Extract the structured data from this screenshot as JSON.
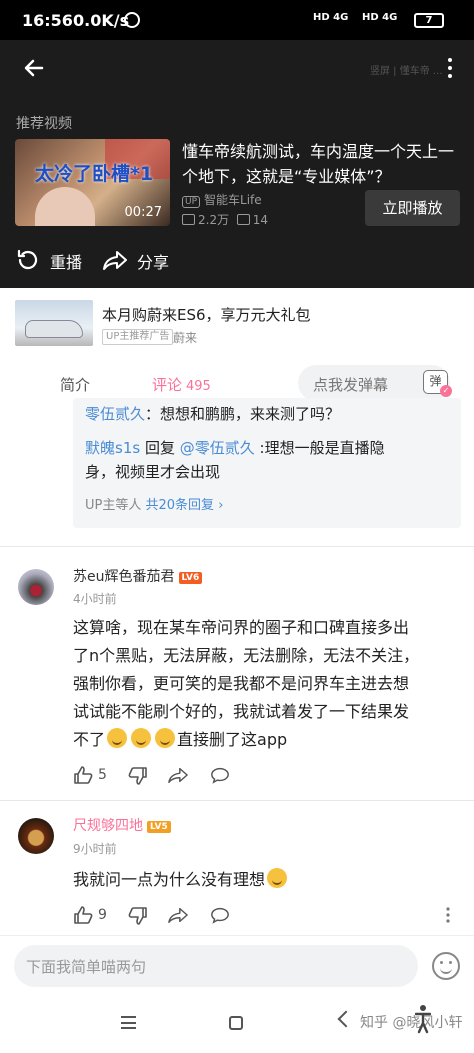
{
  "status_bar": {
    "time": "16:56",
    "net_speed": "0.0K/s",
    "sim1": "HD 4G",
    "sim2": "HD 4G",
    "battery": "7"
  },
  "video_overlay": {
    "ghost_text": "竖屏 | 懂车帝 ..."
  },
  "recommended": {
    "section_title": "推荐视频",
    "thumb_caption": "太冷了卧槽*1",
    "duration": "00:27",
    "title": "懂车帝续航测试，车内温度一个天上一个地下，这就是“专业媒体”？",
    "author_badge": "UP",
    "author": "智能车Life",
    "plays": "2.2万",
    "danmaku": "14",
    "play_now": "立即播放"
  },
  "actions": {
    "replay": "重播",
    "share": "分享"
  },
  "ad": {
    "title": "本月购蔚来ES6，享万元大礼包",
    "tag": "UP主推荐广告",
    "brand": "蔚来"
  },
  "tabs": {
    "intro": "简介",
    "comments": "评论",
    "comment_count": "495",
    "danmaku_placeholder": "点我发弹幕",
    "danmaku_toggle": "弹"
  },
  "reply_thread": {
    "reply1_user": "零伍贰久",
    "reply1_text": "：想想和鹏鹏，来来测了吗？",
    "reply2_user": "默魄s1s",
    "reply2_verb": " 回复 ",
    "reply2_target": "@零伍贰久",
    "reply2_text_line1": " :理想一般是直播隐",
    "reply2_text_line2": "身，视频里才会出现",
    "more_prefix": "UP主等人 ",
    "more_link": "共20条回复 ",
    "more_chevron": "›"
  },
  "comments": [
    {
      "user": "苏eu辉色番茄君",
      "level": "LV6",
      "level_color": "#f25d23",
      "time": "4小时前",
      "text_lines": [
        "这算啥，现在某车帝问界的圈子和口碑直接多出",
        "了n个黑贴，无法屏蔽，无法删除，无法不关注，",
        "强制你看，更可笑的是我都不是问界车主进去想",
        "试试能不能刷个好的，我就试着发了一下结果发"
      ],
      "last_line_start": "不了",
      "last_line_end": "直接删了这app",
      "likes": "5"
    },
    {
      "user": "尺规够四地",
      "level": "LV5",
      "level_color": "#f2a023",
      "name_color": "#fb7299",
      "time": "9小时前",
      "text": "我就问一点为什么没有理想",
      "likes": "9"
    }
  ],
  "bottom": {
    "input_placeholder": "下面我简单喵两句",
    "watermark": "知乎 @晓风小轩"
  },
  "colors": {
    "accent": "#fb7299",
    "link": "#4a8cd4",
    "dark_bg": "#1c1c1c"
  }
}
